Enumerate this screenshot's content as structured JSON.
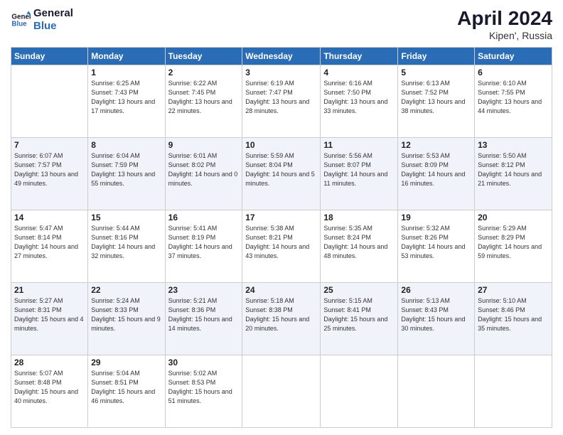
{
  "header": {
    "logo_line1": "General",
    "logo_line2": "Blue",
    "month_title": "April 2024",
    "location": "Kipen', Russia"
  },
  "weekdays": [
    "Sunday",
    "Monday",
    "Tuesday",
    "Wednesday",
    "Thursday",
    "Friday",
    "Saturday"
  ],
  "weeks": [
    [
      {
        "day": "",
        "sunrise": "",
        "sunset": "",
        "daylight": ""
      },
      {
        "day": "1",
        "sunrise": "Sunrise: 6:25 AM",
        "sunset": "Sunset: 7:43 PM",
        "daylight": "Daylight: 13 hours and 17 minutes."
      },
      {
        "day": "2",
        "sunrise": "Sunrise: 6:22 AM",
        "sunset": "Sunset: 7:45 PM",
        "daylight": "Daylight: 13 hours and 22 minutes."
      },
      {
        "day": "3",
        "sunrise": "Sunrise: 6:19 AM",
        "sunset": "Sunset: 7:47 PM",
        "daylight": "Daylight: 13 hours and 28 minutes."
      },
      {
        "day": "4",
        "sunrise": "Sunrise: 6:16 AM",
        "sunset": "Sunset: 7:50 PM",
        "daylight": "Daylight: 13 hours and 33 minutes."
      },
      {
        "day": "5",
        "sunrise": "Sunrise: 6:13 AM",
        "sunset": "Sunset: 7:52 PM",
        "daylight": "Daylight: 13 hours and 38 minutes."
      },
      {
        "day": "6",
        "sunrise": "Sunrise: 6:10 AM",
        "sunset": "Sunset: 7:55 PM",
        "daylight": "Daylight: 13 hours and 44 minutes."
      }
    ],
    [
      {
        "day": "7",
        "sunrise": "Sunrise: 6:07 AM",
        "sunset": "Sunset: 7:57 PM",
        "daylight": "Daylight: 13 hours and 49 minutes."
      },
      {
        "day": "8",
        "sunrise": "Sunrise: 6:04 AM",
        "sunset": "Sunset: 7:59 PM",
        "daylight": "Daylight: 13 hours and 55 minutes."
      },
      {
        "day": "9",
        "sunrise": "Sunrise: 6:01 AM",
        "sunset": "Sunset: 8:02 PM",
        "daylight": "Daylight: 14 hours and 0 minutes."
      },
      {
        "day": "10",
        "sunrise": "Sunrise: 5:59 AM",
        "sunset": "Sunset: 8:04 PM",
        "daylight": "Daylight: 14 hours and 5 minutes."
      },
      {
        "day": "11",
        "sunrise": "Sunrise: 5:56 AM",
        "sunset": "Sunset: 8:07 PM",
        "daylight": "Daylight: 14 hours and 11 minutes."
      },
      {
        "day": "12",
        "sunrise": "Sunrise: 5:53 AM",
        "sunset": "Sunset: 8:09 PM",
        "daylight": "Daylight: 14 hours and 16 minutes."
      },
      {
        "day": "13",
        "sunrise": "Sunrise: 5:50 AM",
        "sunset": "Sunset: 8:12 PM",
        "daylight": "Daylight: 14 hours and 21 minutes."
      }
    ],
    [
      {
        "day": "14",
        "sunrise": "Sunrise: 5:47 AM",
        "sunset": "Sunset: 8:14 PM",
        "daylight": "Daylight: 14 hours and 27 minutes."
      },
      {
        "day": "15",
        "sunrise": "Sunrise: 5:44 AM",
        "sunset": "Sunset: 8:16 PM",
        "daylight": "Daylight: 14 hours and 32 minutes."
      },
      {
        "day": "16",
        "sunrise": "Sunrise: 5:41 AM",
        "sunset": "Sunset: 8:19 PM",
        "daylight": "Daylight: 14 hours and 37 minutes."
      },
      {
        "day": "17",
        "sunrise": "Sunrise: 5:38 AM",
        "sunset": "Sunset: 8:21 PM",
        "daylight": "Daylight: 14 hours and 43 minutes."
      },
      {
        "day": "18",
        "sunrise": "Sunrise: 5:35 AM",
        "sunset": "Sunset: 8:24 PM",
        "daylight": "Daylight: 14 hours and 48 minutes."
      },
      {
        "day": "19",
        "sunrise": "Sunrise: 5:32 AM",
        "sunset": "Sunset: 8:26 PM",
        "daylight": "Daylight: 14 hours and 53 minutes."
      },
      {
        "day": "20",
        "sunrise": "Sunrise: 5:29 AM",
        "sunset": "Sunset: 8:29 PM",
        "daylight": "Daylight: 14 hours and 59 minutes."
      }
    ],
    [
      {
        "day": "21",
        "sunrise": "Sunrise: 5:27 AM",
        "sunset": "Sunset: 8:31 PM",
        "daylight": "Daylight: 15 hours and 4 minutes."
      },
      {
        "day": "22",
        "sunrise": "Sunrise: 5:24 AM",
        "sunset": "Sunset: 8:33 PM",
        "daylight": "Daylight: 15 hours and 9 minutes."
      },
      {
        "day": "23",
        "sunrise": "Sunrise: 5:21 AM",
        "sunset": "Sunset: 8:36 PM",
        "daylight": "Daylight: 15 hours and 14 minutes."
      },
      {
        "day": "24",
        "sunrise": "Sunrise: 5:18 AM",
        "sunset": "Sunset: 8:38 PM",
        "daylight": "Daylight: 15 hours and 20 minutes."
      },
      {
        "day": "25",
        "sunrise": "Sunrise: 5:15 AM",
        "sunset": "Sunset: 8:41 PM",
        "daylight": "Daylight: 15 hours and 25 minutes."
      },
      {
        "day": "26",
        "sunrise": "Sunrise: 5:13 AM",
        "sunset": "Sunset: 8:43 PM",
        "daylight": "Daylight: 15 hours and 30 minutes."
      },
      {
        "day": "27",
        "sunrise": "Sunrise: 5:10 AM",
        "sunset": "Sunset: 8:46 PM",
        "daylight": "Daylight: 15 hours and 35 minutes."
      }
    ],
    [
      {
        "day": "28",
        "sunrise": "Sunrise: 5:07 AM",
        "sunset": "Sunset: 8:48 PM",
        "daylight": "Daylight: 15 hours and 40 minutes."
      },
      {
        "day": "29",
        "sunrise": "Sunrise: 5:04 AM",
        "sunset": "Sunset: 8:51 PM",
        "daylight": "Daylight: 15 hours and 46 minutes."
      },
      {
        "day": "30",
        "sunrise": "Sunrise: 5:02 AM",
        "sunset": "Sunset: 8:53 PM",
        "daylight": "Daylight: 15 hours and 51 minutes."
      },
      {
        "day": "",
        "sunrise": "",
        "sunset": "",
        "daylight": ""
      },
      {
        "day": "",
        "sunrise": "",
        "sunset": "",
        "daylight": ""
      },
      {
        "day": "",
        "sunrise": "",
        "sunset": "",
        "daylight": ""
      },
      {
        "day": "",
        "sunrise": "",
        "sunset": "",
        "daylight": ""
      }
    ]
  ]
}
